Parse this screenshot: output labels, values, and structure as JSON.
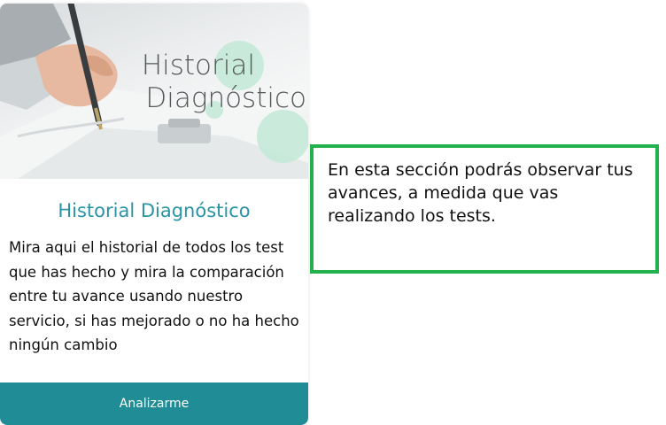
{
  "card": {
    "image_overlay_line1": "Historial",
    "image_overlay_line2": "Diagnóstico",
    "title": "Historial Diagnóstico",
    "description": "Mira aqui el historial de todos los test que has hecho y mira la comparación entre tu avance usando nuestro servicio, si has mejorado o no ha hecho ningún cambio",
    "button_label": "Analizarme",
    "accent_color": "#2a94a5",
    "button_color": "#1f8c96"
  },
  "tooltip": {
    "text": "En esta sección podrás observar tus avances, a medida que vas realizando los tests.",
    "border_color": "#22b14c"
  }
}
